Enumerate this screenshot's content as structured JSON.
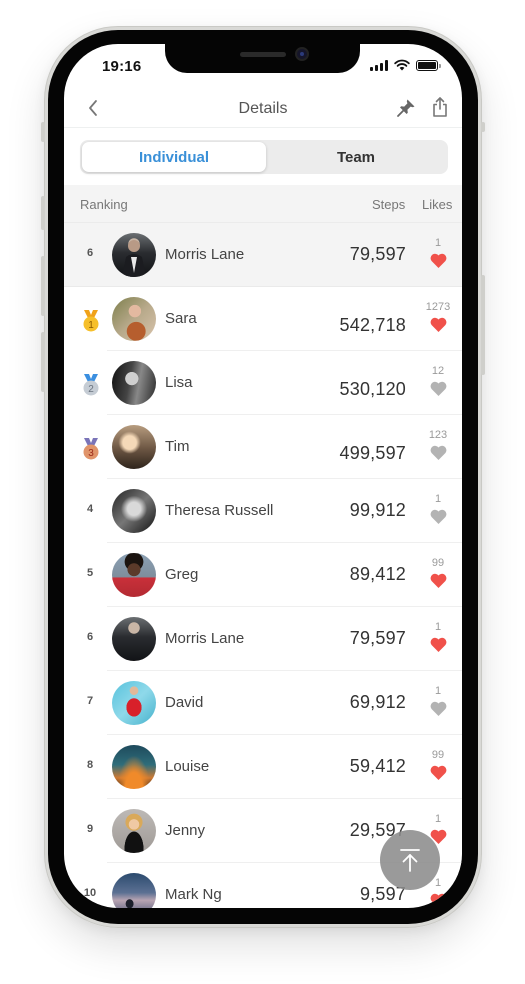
{
  "status_bar": {
    "time": "19:16"
  },
  "nav": {
    "title": "Details",
    "back_icon": "chevron-left-icon",
    "pin_icon": "pin-icon",
    "share_icon": "share-icon"
  },
  "segmented": {
    "tabs": [
      {
        "label": "Individual",
        "active": true
      },
      {
        "label": "Team",
        "active": false
      }
    ]
  },
  "colors": {
    "accent": "#3a90d8",
    "heart_liked": "#f0514a",
    "heart_unliked": "#b3b3b3",
    "gold": "#f6bf2a",
    "silver": "#c5ccd4",
    "bronze": "#e0946a"
  },
  "list_header": {
    "ranking": "Ranking",
    "steps": "Steps",
    "likes": "Likes"
  },
  "me": {
    "rank": "6",
    "name": "Morris Lane",
    "steps": "79,597",
    "likes": "1",
    "liked": true
  },
  "rows": [
    {
      "rank": "1",
      "medal": "gold",
      "name": "Sara",
      "steps": "542,718",
      "likes": "1273",
      "liked": true
    },
    {
      "rank": "2",
      "medal": "silver",
      "name": "Lisa",
      "steps": "530,120",
      "likes": "12",
      "liked": false
    },
    {
      "rank": "3",
      "medal": "bronze",
      "name": "Tim",
      "steps": "499,597",
      "likes": "123",
      "liked": false
    },
    {
      "rank": "4",
      "name": "Theresa Russell",
      "steps": "99,912",
      "likes": "1",
      "liked": false
    },
    {
      "rank": "5",
      "name": "Greg",
      "steps": "89,412",
      "likes": "99",
      "liked": true
    },
    {
      "rank": "6",
      "name": "Morris Lane",
      "steps": "79,597",
      "likes": "1",
      "liked": true
    },
    {
      "rank": "7",
      "name": "David",
      "steps": "69,912",
      "likes": "1",
      "liked": false
    },
    {
      "rank": "8",
      "name": "Louise",
      "steps": "59,412",
      "likes": "99",
      "liked": true
    },
    {
      "rank": "9",
      "name": "Jenny",
      "steps": "29,597",
      "likes": "1",
      "liked": true
    },
    {
      "rank": "10",
      "name": "Mark Ng",
      "steps": "9,597",
      "likes": "1",
      "liked": true
    }
  ],
  "fab": {
    "icon": "scroll-to-top-icon"
  }
}
